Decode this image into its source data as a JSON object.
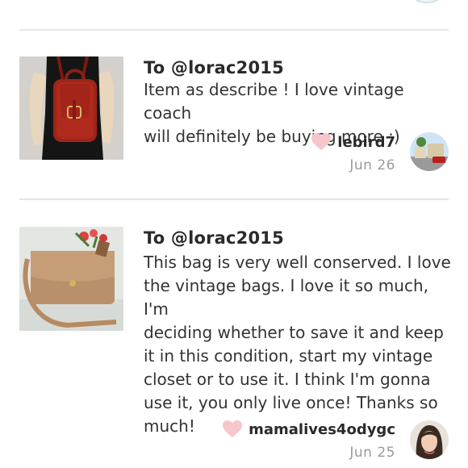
{
  "reviews": [
    {
      "to": "To @lorac2015",
      "text_lines": [
        "Item as describe ! I love vintage coach",
        "will definitely be buying more :)"
      ],
      "username": "lebird7",
      "date": "Jun 26",
      "thumbnail_icon": "red-leather-backpack-photo",
      "avatar_icon": "street-scene-avatar"
    },
    {
      "to": "To @lorac2015",
      "text_lines": [
        "This bag is very well conserved. I love",
        "the vintage bags. I love it so much, I'm",
        "deciding whether to save it and keep",
        "it in this condition, start my vintage",
        "closet or to use it. I think I'm gonna",
        "use it, you only live once! Thanks so",
        "much!"
      ],
      "username": "mamalives4odygc",
      "date": "Jun 25",
      "thumbnail_icon": "tan-leather-bag-photo",
      "avatar_icon": "woman-portrait-avatar"
    }
  ],
  "colors": {
    "heart": "#f7c6ca",
    "divider": "#e6e6e6",
    "date": "#9b9b9b"
  }
}
